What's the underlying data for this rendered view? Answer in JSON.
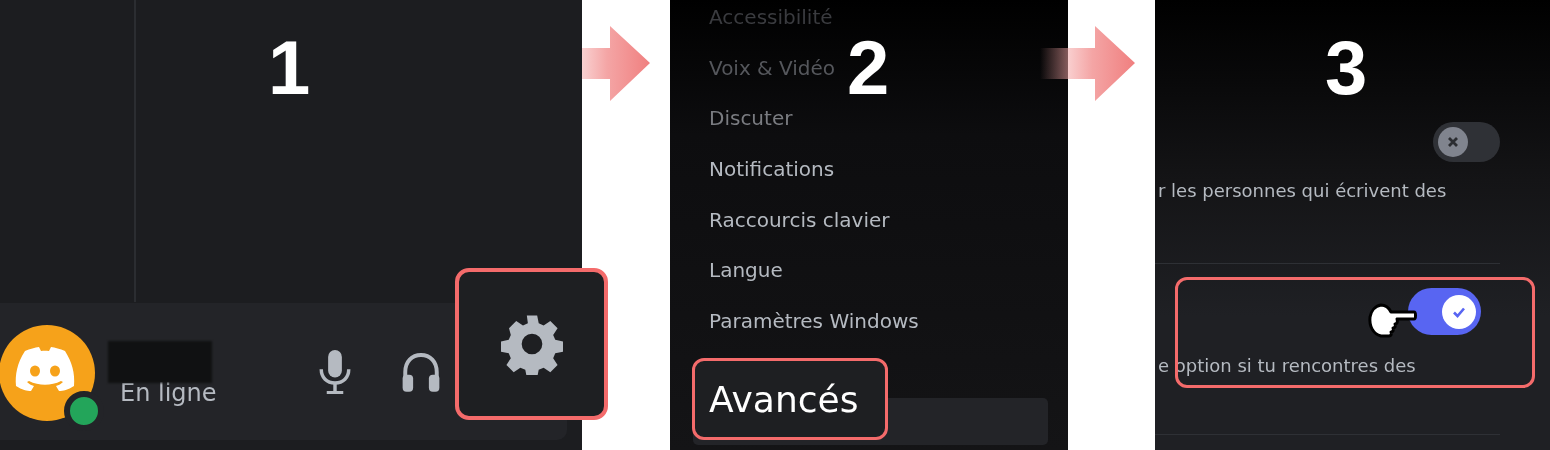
{
  "step_1": {
    "number": "1",
    "user": {
      "status": "En ligne"
    }
  },
  "step_2": {
    "number": "2",
    "settings_menu": [
      {
        "label": "Accessibilité",
        "selected": false
      },
      {
        "label": "Voix & Vidéo",
        "selected": false
      },
      {
        "label": "Discuter",
        "selected": false
      },
      {
        "label": "Notifications",
        "selected": false
      },
      {
        "label": "Raccourcis clavier",
        "selected": false
      },
      {
        "label": "Langue",
        "selected": false
      },
      {
        "label": "Paramètres Windows",
        "selected": false
      },
      {
        "label": "Avancés",
        "selected": true
      }
    ]
  },
  "step_3": {
    "number": "3",
    "settings": [
      {
        "description": "r les personnes qui écrivent des",
        "on": false
      },
      {
        "description": "e option si tu rencontres des",
        "on": true
      }
    ]
  }
}
